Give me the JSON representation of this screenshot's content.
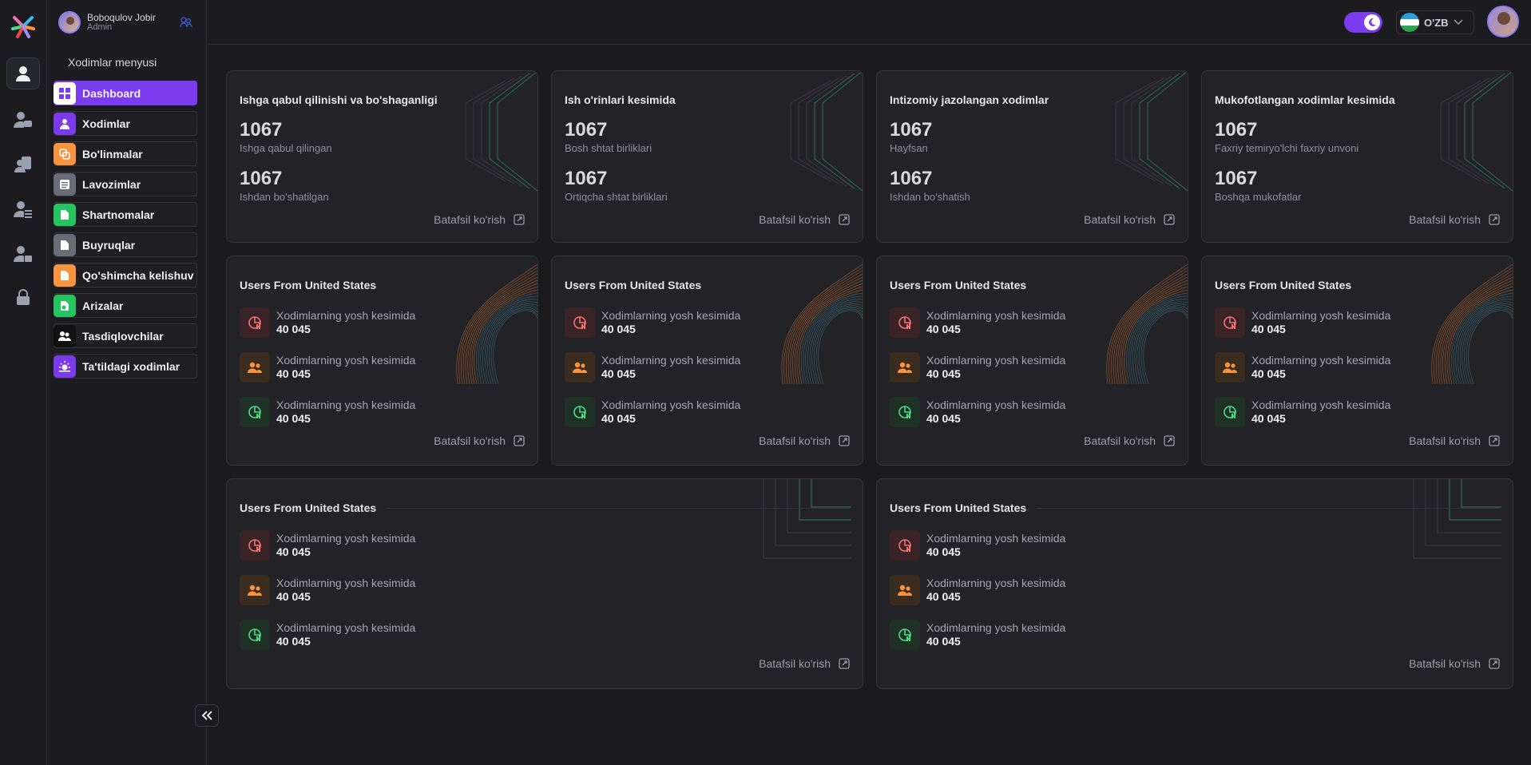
{
  "user": {
    "name": "Boboqulov Jobir",
    "role": "Admin"
  },
  "sidebar": {
    "title": "Xodimlar menyusi",
    "items": [
      {
        "label": "Dashboard",
        "icon": "grid-icon",
        "color": "#ffffff"
      },
      {
        "label": "Xodimlar",
        "icon": "user-icon",
        "color": "#7c3aed"
      },
      {
        "label": "Bo'linmalar",
        "icon": "departments-icon",
        "color": "#fb923c"
      },
      {
        "label": "Lavozimlar",
        "icon": "list-icon",
        "color": "#6b6b78"
      },
      {
        "label": "Shartnomalar",
        "icon": "document-icon",
        "color": "#22c55e"
      },
      {
        "label": "Buyruqlar",
        "icon": "file-icon",
        "color": "#6b6b78"
      },
      {
        "label": "Qo'shimcha kelishuv",
        "icon": "file-plus-icon",
        "color": "#fb923c"
      },
      {
        "label": "Arizalar",
        "icon": "application-icon",
        "color": "#22c55e"
      },
      {
        "label": "Tasdiqlovchilar",
        "icon": "users-icon",
        "color": "#111111"
      },
      {
        "label": "Ta'tildagi xodimlar",
        "icon": "sun-icon",
        "color": "#7c3aed"
      }
    ]
  },
  "topbar": {
    "language": "O'ZB",
    "theme": "dark"
  },
  "stat_cards": [
    {
      "title": "Ishga qabul qilinishi va bo'shaganligi",
      "stats": [
        {
          "value": "1067",
          "label": "Ishga qabul qilingan"
        },
        {
          "value": "1067",
          "label": "Ishdan bo'shatilgan"
        }
      ],
      "link": "Batafsil ko'rish"
    },
    {
      "title": "Ish o'rinlari kesimida",
      "stats": [
        {
          "value": "1067",
          "label": "Bosh shtat birliklari"
        },
        {
          "value": "1067",
          "label": "Ortiqcha shtat birliklari"
        }
      ],
      "link": "Batafsil ko'rish"
    },
    {
      "title": "Intizomiy jazolangan xodimlar",
      "stats": [
        {
          "value": "1067",
          "label": "Hayfsan"
        },
        {
          "value": "1067",
          "label": "Ishdan bo'shatish"
        }
      ],
      "link": "Batafsil ko'rish"
    },
    {
      "title": "Mukofotlangan xodimlar kesimida",
      "stats": [
        {
          "value": "1067",
          "label": "Faxriy temiryo'lchi faxriy unvoni"
        },
        {
          "value": "1067",
          "label": "Boshqa mukofatlar"
        }
      ],
      "link": "Batafsil ko'rish"
    }
  ],
  "list_cards": [
    {
      "title": "Users From United States",
      "rows": [
        {
          "label": "Xodimlarning yosh kesimida",
          "value": "40 045"
        },
        {
          "label": "Xodimlarning yosh kesimida",
          "value": "40 045"
        },
        {
          "label": "Xodimlarning yosh kesimida",
          "value": "40 045"
        }
      ],
      "link": "Batafsil ko'rish"
    },
    {
      "title": "Users From United States",
      "rows": [
        {
          "label": "Xodimlarning yosh kesimida",
          "value": "40 045"
        },
        {
          "label": "Xodimlarning yosh kesimida",
          "value": "40 045"
        },
        {
          "label": "Xodimlarning yosh kesimida",
          "value": "40 045"
        }
      ],
      "link": "Batafsil ko'rish"
    },
    {
      "title": "Users From United States",
      "rows": [
        {
          "label": "Xodimlarning yosh kesimida",
          "value": "40 045"
        },
        {
          "label": "Xodimlarning yosh kesimida",
          "value": "40 045"
        },
        {
          "label": "Xodimlarning yosh kesimida",
          "value": "40 045"
        }
      ],
      "link": "Batafsil ko'rish"
    },
    {
      "title": "Users From United States",
      "rows": [
        {
          "label": "Xodimlarning yosh kesimida",
          "value": "40 045"
        },
        {
          "label": "Xodimlarning yosh kesimida",
          "value": "40 045"
        },
        {
          "label": "Xodimlarning yosh kesimida",
          "value": "40 045"
        }
      ],
      "link": "Batafsil ko'rish"
    }
  ],
  "wide_cards": [
    {
      "title": "Users From United States",
      "rows": [
        {
          "label": "Xodimlarning yosh kesimida",
          "value": "40 045"
        },
        {
          "label": "Xodimlarning yosh kesimida",
          "value": "40 045"
        },
        {
          "label": "Xodimlarning yosh kesimida",
          "value": "40 045"
        }
      ],
      "link": "Batafsil ko'rish"
    },
    {
      "title": "Users From United States",
      "rows": [
        {
          "label": "Xodimlarning yosh kesimida",
          "value": "40 045"
        },
        {
          "label": "Xodimlarning yosh kesimida",
          "value": "40 045"
        },
        {
          "label": "Xodimlarning yosh kesimida",
          "value": "40 045"
        }
      ],
      "link": "Batafsil ko'rish"
    }
  ],
  "row_colors": {
    "red": "#f87171",
    "orange": "#fb923c",
    "green": "#4ade80"
  }
}
